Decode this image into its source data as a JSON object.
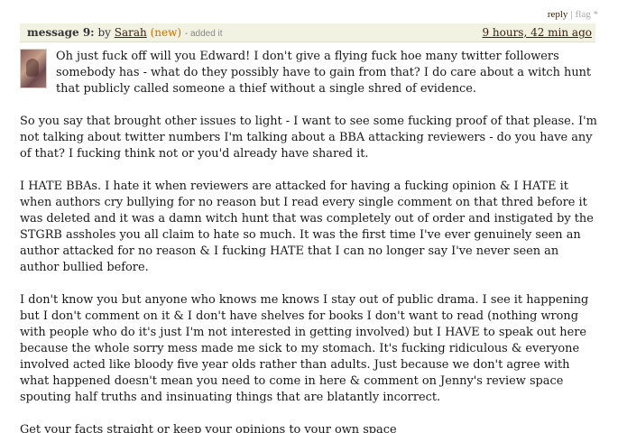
{
  "actions": {
    "reply": "reply",
    "separator": "|",
    "flag": "flag *"
  },
  "message": {
    "number_label": "message 9:",
    "by": "by",
    "author": "Sarah",
    "new_badge": "(new)",
    "added": "- added it",
    "timestamp": "9 hours, 42 min ago",
    "paragraphs": [
      "Oh just fuck off will you Edward! I don't give a flying fuck hoe many twitter followers somebody has - what do they possibly have to gain from that? I do care about a witch hunt that publicly called someone a thief without a single shred of evidence.",
      "So you say that brought other issues to light - I want to see some fucking proof of that please. I'm not talking about twitter numbers I'm talking about a BBA attacking reviewers - do you have any of that? I fucking think not or you'd already have shared it.",
      "I HATE BBAs. I hate it when reviewers are attacked for having a fucking opinion & I HATE it when authors cry bullying for no reason but I read every single comment on that thred before it was deleted and it was a damn witch hunt that was completely out of order and instigated by the STGRB assholes you all claim to hate so much. It was the first time I've ever genuinely seen an author attacked for no reason & I fucking HATE that I can no longer say I've never seen an author bullied before.",
      "I don't know you but anyone who knows me knows I stay out of public drama. I see it happening but I don't comment on it & I don't have shelves for books I don't want to read (nothing wrong with people who do it's just I'm not interested in getting involved) but I HAVE to speak out here because the whole sorry mess made me sick to my stomach. It's fucking ridiculous & everyone involved acted like bloody five year olds rather than adults. Just because we don't agree with what happened doesn't mean you need to come in here & comment on Jenny's review space spouting half truths and insinuating things that are blatantly incorrect.",
      "Get your facts straight or keep your opinions to your own space"
    ]
  }
}
